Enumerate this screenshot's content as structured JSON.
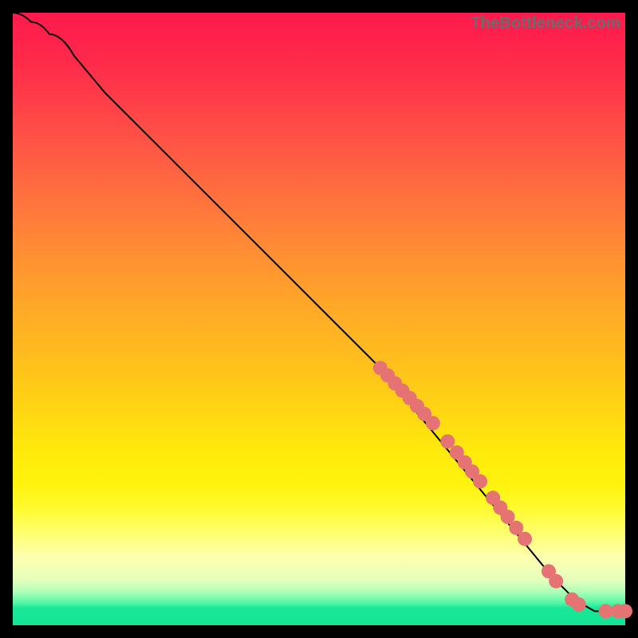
{
  "watermark": "TheBottleneck.com",
  "chart_data": {
    "type": "line",
    "title": "",
    "xlabel": "",
    "ylabel": "",
    "xlim": [
      0,
      100
    ],
    "ylim": [
      0,
      100
    ],
    "grid": false,
    "legend": false,
    "curve": [
      {
        "x": 0,
        "y": 100
      },
      {
        "x": 3,
        "y": 98.5
      },
      {
        "x": 6,
        "y": 96.5
      },
      {
        "x": 10,
        "y": 93
      },
      {
        "x": 15,
        "y": 87
      },
      {
        "x": 60,
        "y": 42
      },
      {
        "x": 88,
        "y": 8
      },
      {
        "x": 92,
        "y": 4
      },
      {
        "x": 95,
        "y": 2.3
      },
      {
        "x": 100,
        "y": 2.3
      }
    ],
    "points": [
      {
        "x": 60.0,
        "y": 42.0
      },
      {
        "x": 61.2,
        "y": 40.8
      },
      {
        "x": 62.4,
        "y": 39.5
      },
      {
        "x": 63.6,
        "y": 38.3
      },
      {
        "x": 64.8,
        "y": 37.1
      },
      {
        "x": 66.0,
        "y": 35.8
      },
      {
        "x": 67.2,
        "y": 34.5
      },
      {
        "x": 68.6,
        "y": 33.0
      },
      {
        "x": 71.0,
        "y": 30.0
      },
      {
        "x": 72.5,
        "y": 28.2
      },
      {
        "x": 73.8,
        "y": 26.6
      },
      {
        "x": 75.0,
        "y": 25.1
      },
      {
        "x": 76.3,
        "y": 23.5
      },
      {
        "x": 78.4,
        "y": 20.8
      },
      {
        "x": 79.6,
        "y": 19.2
      },
      {
        "x": 80.8,
        "y": 17.7
      },
      {
        "x": 82.2,
        "y": 15.9
      },
      {
        "x": 83.6,
        "y": 14.1
      },
      {
        "x": 87.5,
        "y": 8.8
      },
      {
        "x": 88.7,
        "y": 7.2
      },
      {
        "x": 91.3,
        "y": 4.2
      },
      {
        "x": 92.4,
        "y": 3.4
      },
      {
        "x": 96.8,
        "y": 2.3
      },
      {
        "x": 98.8,
        "y": 2.3
      },
      {
        "x": 100.0,
        "y": 2.3
      }
    ],
    "point_color": "#e57373",
    "point_radius_px": 9
  }
}
